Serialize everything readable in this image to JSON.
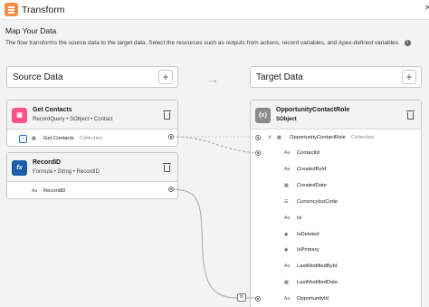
{
  "window": {
    "title": "Transform",
    "close_glyph": "×"
  },
  "heading": "Map Your Data",
  "description": "The flow transforms the source data to the target data. Select the resources such as outputs from actions, record variables, and Apex-defined variables.",
  "source": {
    "header": "Source Data",
    "cards": [
      {
        "title": "Get Contacts",
        "meta": "RecordQuery  •  SObject  •  Contact",
        "icon": "get-records-icon",
        "color": "#ff538a",
        "row": {
          "name": "Get Contacts",
          "type": "Collection"
        }
      },
      {
        "title": "RecordID",
        "meta": "Formula  •  String  •  RecordID",
        "icon": "formula-icon",
        "color": "#1b5fa8",
        "row": {
          "type_glyph": "Aa",
          "name": "RecordID"
        }
      }
    ]
  },
  "target": {
    "header": "Target Data",
    "card": {
      "title": "OpportunityContactRole",
      "meta": "SObject",
      "icon": "sobject-icon",
      "color": "#8a8a8a"
    },
    "root": {
      "name": "OpportunityContactRole",
      "type": "Collection"
    },
    "fields": [
      {
        "name": "ContactId",
        "glyph": "Aa",
        "mapped": true
      },
      {
        "name": "CreatedById",
        "glyph": "Aa",
        "mapped": false
      },
      {
        "name": "CreatedDate",
        "glyph": "cal",
        "mapped": false
      },
      {
        "name": "CurrencyIsoCode",
        "glyph": "list",
        "mapped": false
      },
      {
        "name": "Id",
        "glyph": "Aa",
        "mapped": false
      },
      {
        "name": "IsDeleted",
        "glyph": "bool",
        "mapped": false
      },
      {
        "name": "IsPrimary",
        "glyph": "bool",
        "mapped": false
      },
      {
        "name": "LastModifiedById",
        "glyph": "Aa",
        "mapped": false
      },
      {
        "name": "LastModifiedDate",
        "glyph": "cal",
        "mapped": false
      },
      {
        "name": "OpportunityId",
        "glyph": "Aa",
        "mapped": true
      }
    ]
  },
  "mapping_formula_label": "fx",
  "colors": {
    "accent": "#1b6fc7",
    "wire": "#a8a8a8"
  }
}
